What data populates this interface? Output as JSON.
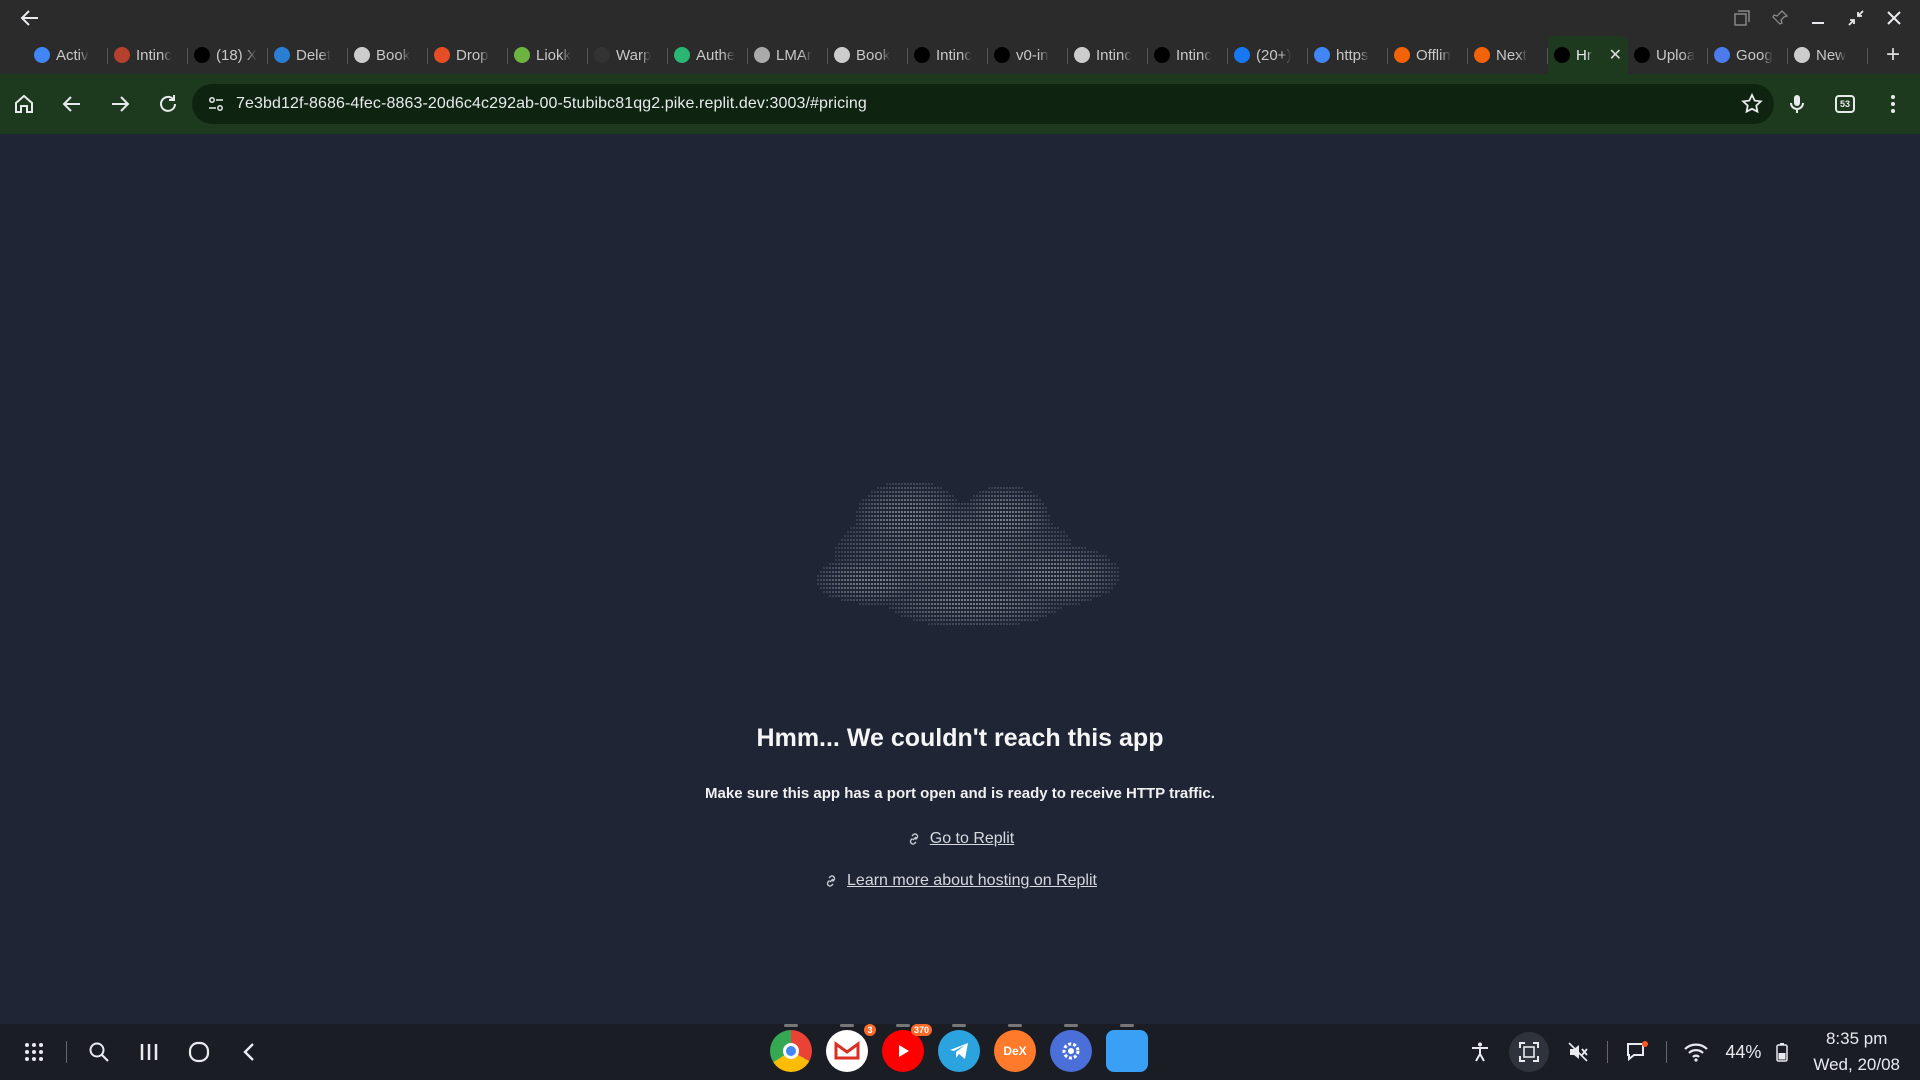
{
  "tabs": [
    {
      "label": "Activ",
      "icon": "google-icon",
      "color": "#4285f4"
    },
    {
      "label": "Intinc",
      "icon": "intinc-icon",
      "color": "#b5402d"
    },
    {
      "label": "(18) X",
      "icon": "x-icon",
      "color": "#000000"
    },
    {
      "label": "Delet",
      "icon": "edge-icon",
      "color": "#2a7fd4"
    },
    {
      "label": "Book",
      "icon": "openai-icon",
      "color": "#cccccc"
    },
    {
      "label": "Drop",
      "icon": "drop-icon",
      "color": "#e44d26"
    },
    {
      "label": "Liokk",
      "icon": "liokk-icon",
      "color": "#6db33f"
    },
    {
      "label": "Warp",
      "icon": "warp-icon",
      "color": "#333333"
    },
    {
      "label": "Authe",
      "icon": "auth-icon",
      "color": "#2bb673"
    },
    {
      "label": "LMAr",
      "icon": "grid-icon",
      "color": "#aaaaaa"
    },
    {
      "label": "Book",
      "icon": "openai-icon",
      "color": "#cccccc"
    },
    {
      "label": "Intinc",
      "icon": "v0-icon",
      "color": "#000000"
    },
    {
      "label": "v0-in",
      "icon": "vercel-icon",
      "color": "#000000"
    },
    {
      "label": "Intinc",
      "icon": "openai-icon",
      "color": "#cccccc"
    },
    {
      "label": "Intinc",
      "icon": "v0-icon",
      "color": "#000000"
    },
    {
      "label": "(20+)",
      "icon": "facebook-icon",
      "color": "#1877f2"
    },
    {
      "label": "https",
      "icon": "google-icon",
      "color": "#4285f4"
    },
    {
      "label": "Offlin",
      "icon": "replit-icon",
      "color": "#f26207"
    },
    {
      "label": "Next",
      "icon": "replit-icon",
      "color": "#f26207"
    },
    {
      "label": "Hr",
      "icon": "vercel-icon",
      "color": "#000000",
      "active": true
    },
    {
      "label": "Uploa",
      "icon": "github-icon",
      "color": "#000000"
    },
    {
      "label": "Goog",
      "icon": "gemini-icon",
      "color": "#4b7bec"
    },
    {
      "label": "New",
      "icon": "openai-icon",
      "color": "#cccccc"
    }
  ],
  "address_bar": {
    "url": "7e3bd12f-8686-4fec-8863-20d6c4c292ab-00-5tubibc81qg2.pike.replit.dev:3003/#pricing"
  },
  "toolbar": {
    "extension_badge": "53"
  },
  "error_page": {
    "title": "Hmm... We couldn't reach this app",
    "subtitle": "Make sure this app has a port open and is ready to receive HTTP traffic.",
    "link_go": "Go to Replit",
    "link_learn": "Learn more about hosting on Replit"
  },
  "taskbar": {
    "apps": [
      {
        "name": "chrome",
        "badge": ""
      },
      {
        "name": "gmail",
        "badge": "3"
      },
      {
        "name": "youtube",
        "badge": "370"
      },
      {
        "name": "telegram",
        "badge": ""
      },
      {
        "name": "dex",
        "badge": "",
        "label": "DeX"
      },
      {
        "name": "settings",
        "badge": ""
      },
      {
        "name": "files",
        "badge": ""
      }
    ],
    "battery": "44%",
    "time": "8:35 pm",
    "date": "Wed, 20/08"
  },
  "colors": {
    "page_bg": "#1f2535",
    "toolbar_bg": "#1e3a1e",
    "tabstrip_bg": "#2b2b2b"
  }
}
